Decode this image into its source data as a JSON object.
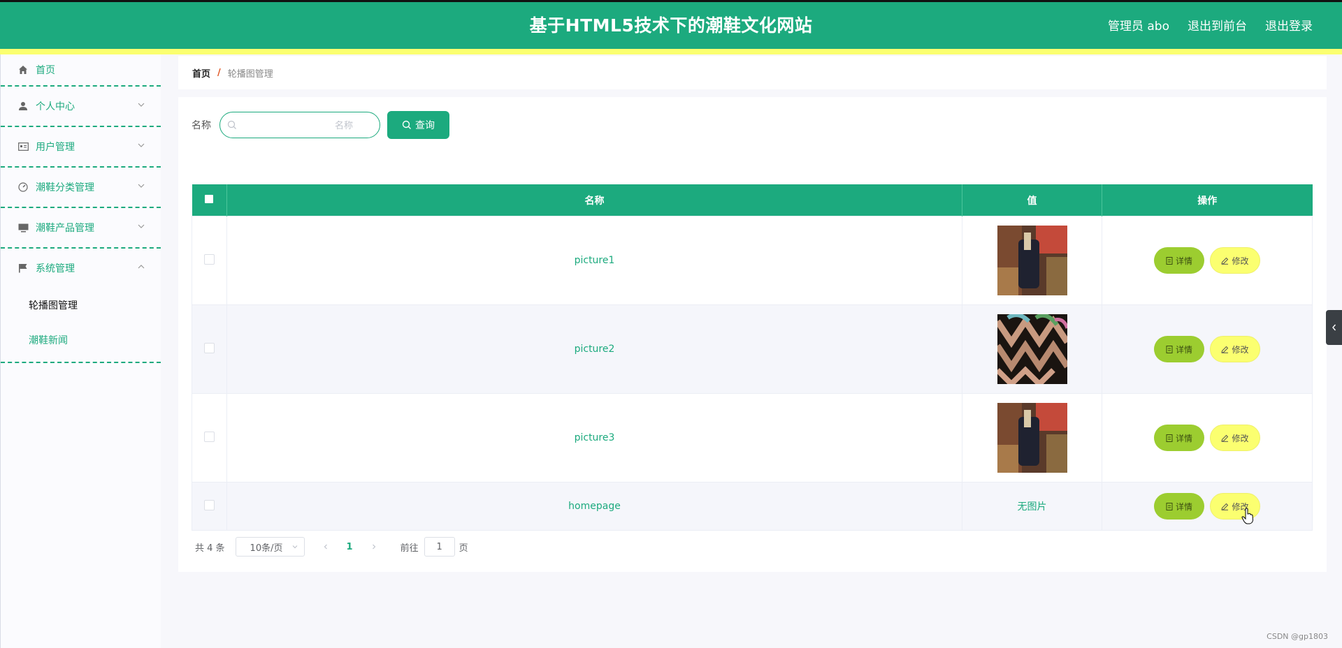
{
  "header": {
    "title": "基于HTML5技术下的潮鞋文化网站",
    "user": "管理员 abo",
    "to_front": "退出到前台",
    "logout": "退出登录"
  },
  "sidebar": {
    "items": [
      {
        "label": "首页",
        "icon": "home-icon"
      },
      {
        "label": "个人中心",
        "icon": "person-icon"
      },
      {
        "label": "用户管理",
        "icon": "id-card-icon"
      },
      {
        "label": "潮鞋分类管理",
        "icon": "gauge-icon"
      },
      {
        "label": "潮鞋产品管理",
        "icon": "monitor-icon"
      },
      {
        "label": "系统管理",
        "icon": "flag-icon"
      }
    ],
    "sub_items": [
      {
        "label": "轮播图管理",
        "active": true
      },
      {
        "label": "潮鞋新闻",
        "active": false
      }
    ]
  },
  "breadcrumb": {
    "home": "首页",
    "separator": "/",
    "current": "轮播图管理"
  },
  "search": {
    "label": "名称",
    "placeholder": "名称",
    "value": "",
    "button": "查询"
  },
  "table": {
    "headers": [
      "名称",
      "值",
      "操作"
    ],
    "rows": [
      {
        "name": "picture1",
        "value_type": "image",
        "image": "thumb-shoe-dark"
      },
      {
        "name": "picture2",
        "value_type": "image",
        "image": "thumb-shoe-laces"
      },
      {
        "name": "picture3",
        "value_type": "image",
        "image": "thumb-shoe-dark"
      },
      {
        "name": "homepage",
        "value_type": "text",
        "value_text": "无图片"
      }
    ],
    "detail_label": "详情",
    "edit_label": "修改"
  },
  "pagination": {
    "total": "共 4 条",
    "page_size": "10条/页",
    "current_page": "1",
    "goto_label": "前往",
    "goto_value": "1",
    "page_unit": "页"
  },
  "watermark": "CSDN @gp1803",
  "colors": {
    "primary": "#1caa7e",
    "accent_yellow": "#fbff70",
    "detail_green": "#9ccd30"
  }
}
